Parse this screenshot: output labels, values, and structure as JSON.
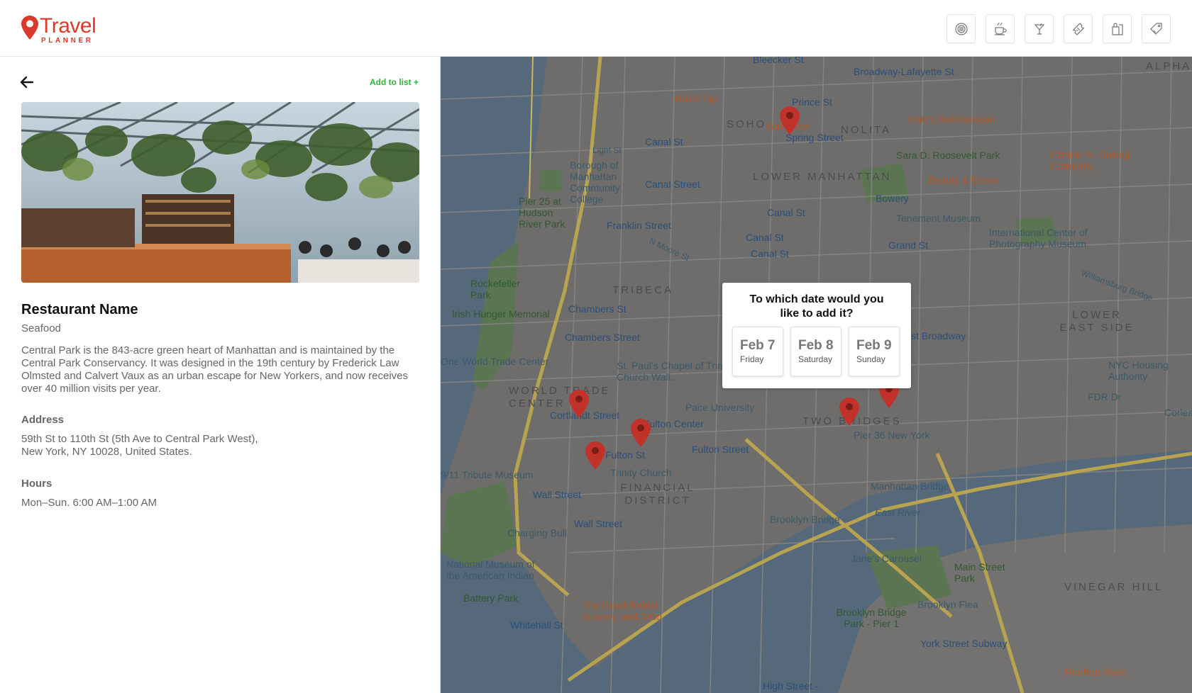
{
  "app": {
    "logo_title": "Travel",
    "logo_subtitle": "PLANNER",
    "brand_color": "#d93a2b",
    "accent_color": "#2db33d"
  },
  "categories": [
    {
      "icon": "attractions-icon"
    },
    {
      "icon": "cafe-icon"
    },
    {
      "icon": "bar-icon"
    },
    {
      "icon": "tickets-icon"
    },
    {
      "icon": "shopping-icon"
    },
    {
      "icon": "deals-icon"
    }
  ],
  "detail": {
    "add_to_list": "Add to list +",
    "name": "Restaurant Name",
    "cuisine": "Seafood",
    "description": "Central Park is the 843-acre green heart of Manhattan and is maintained by the Central Park Conservancy. It was designed in the 19th century by Frederick Law Olmsted and Calvert Vaux as an urban escape for New Yorkers, and now receives over 40 million visits per year.",
    "address_label": "Address",
    "address_line1": "59th St to 110th St (5th Ave to Central Park West),",
    "address_line2": "New York, NY 10028, United States.",
    "hours_label": "Hours",
    "hours_value": "Mon–Sun. 6:00 AM–1:00 AM"
  },
  "popup": {
    "title": "To which date would you like to add it?",
    "dates": [
      {
        "date": "Feb 7",
        "day": "Friday"
      },
      {
        "date": "Feb 8",
        "day": "Saturday"
      },
      {
        "date": "Feb 9",
        "day": "Sunday"
      }
    ]
  },
  "map": {
    "labels": {
      "soho": "SOHO",
      "nolita": "NOLITA",
      "lower_manhattan": "LOWER MANHATTAN",
      "tribeca": "TRIBECA",
      "lower_east_side": "LOWER EAST SIDE",
      "world_trade_center": "WORLD TRADE CENTER",
      "two_bridges": "TWO BRIDGES",
      "financial_district": "FINANCIAL DISTRICT",
      "vinegar_hill": "VINEGAR HILL",
      "alpha": "ALPHA",
      "black_tap": "Black Tap",
      "balthazar": "Balthazar",
      "katz": "Katz's Delicatessen",
      "clinton": "Clinton St. Baking Company",
      "beauty_essex": "Beauty & Essex",
      "sara_park": "Sara D. Roosevelt Park",
      "tenement": "Tenement Museum",
      "icp": "International Center of Photography Museum",
      "bmcc": "Borough of Manhattan Community College",
      "pier25": "Pier 25 at Hudson River Park",
      "rockefeller": "Rockefeller Park",
      "irish": "Irish Hunger Memorial",
      "owtc": "One World Trade Center",
      "st_pauls": "St. Paul's Chapel of Trinity Church Wall...",
      "pace": "Pace University",
      "fulton_center": "Fulton Center",
      "trinity": "Trinity Church",
      "tribute": "9/11 Tribute Museum",
      "charging_bull": "Charging Bull",
      "nmai": "National Museum of the American Indian",
      "battery": "Battery Park",
      "dead_rabbit": "The Dead Rabbit Grocery and Grog",
      "brooklyn_bridge": "Brooklyn Bridge",
      "manhattan_bridge": "Manhattan Bridge",
      "pier36": "Pier 36 New York",
      "janes": "Jane's Carousel",
      "main_street_park": "Main Street Park",
      "bb_pier1": "Brooklyn Bridge Park - Pier 1",
      "brooklyn_flea": "Brooklyn Flea",
      "york_subway": "York Street Subway",
      "rooftop": "Rooftop Reds",
      "nyc_housing": "NYC Housing Authority",
      "corlear": "Corlear",
      "east_river": "East River",
      "fdr": "FDR Dr",
      "bleecker": "Bleecker St",
      "broadway_lafayette": "Broadway-Lafayette St",
      "prince": "Prince St",
      "spring": "Spring Street",
      "canal1": "Canal St",
      "canal2": "Canal Street",
      "canal3": "Canal St",
      "canal4": "Canal St",
      "canal5": "Canal St",
      "bowery": "Bowery",
      "grand": "Grand St",
      "franklin": "Franklin Street",
      "chambers1": "Chambers St",
      "chambers2": "Chambers Street",
      "east_broadway": "East Broadway",
      "cortlandt": "Cortlandt Street",
      "fulton1": "Fulton St",
      "fulton2": "Fulton Street",
      "wall1": "Wall Street",
      "wall2": "Wall Street",
      "whitehall": "Whitehall St",
      "high_street": "High Street -",
      "williamsburg": "Williamsburg Bridge",
      "light": "Light St",
      "north_moore": "N Moore St"
    }
  }
}
